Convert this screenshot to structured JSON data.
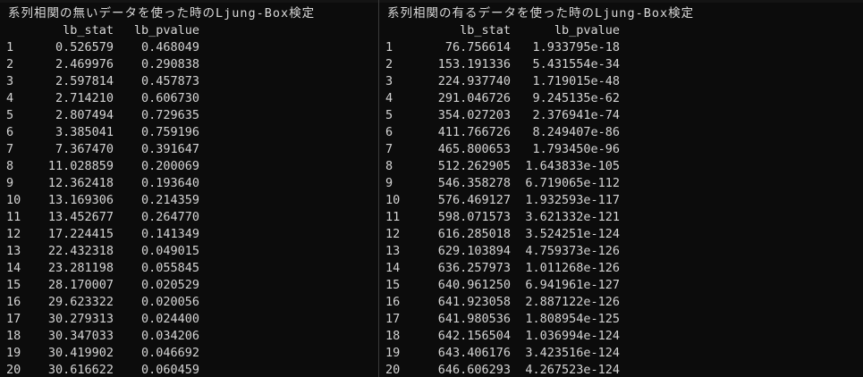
{
  "colors": {
    "background": "#0c0c0c",
    "text": "#d4d4d4",
    "divider": "#3a3a3a"
  },
  "left": {
    "title": "系列相関の無いデータを使った時のLjung-Box検定",
    "columns": {
      "stat": "lb_stat",
      "pval": "lb_pvalue"
    },
    "rows": [
      [
        "1",
        "0.526579",
        "0.468049"
      ],
      [
        "2",
        "2.469976",
        "0.290838"
      ],
      [
        "3",
        "2.597814",
        "0.457873"
      ],
      [
        "4",
        "2.714210",
        "0.606730"
      ],
      [
        "5",
        "2.807494",
        "0.729635"
      ],
      [
        "6",
        "3.385041",
        "0.759196"
      ],
      [
        "7",
        "7.367470",
        "0.391647"
      ],
      [
        "8",
        "11.028859",
        "0.200069"
      ],
      [
        "9",
        "12.362418",
        "0.193640"
      ],
      [
        "10",
        "13.169306",
        "0.214359"
      ],
      [
        "11",
        "13.452677",
        "0.264770"
      ],
      [
        "12",
        "17.224415",
        "0.141349"
      ],
      [
        "13",
        "22.432318",
        "0.049015"
      ],
      [
        "14",
        "23.281198",
        "0.055845"
      ],
      [
        "15",
        "28.170007",
        "0.020529"
      ],
      [
        "16",
        "29.623322",
        "0.020056"
      ],
      [
        "17",
        "30.279313",
        "0.024400"
      ],
      [
        "18",
        "30.347033",
        "0.034206"
      ],
      [
        "19",
        "30.419902",
        "0.046692"
      ],
      [
        "20",
        "30.616622",
        "0.060459"
      ]
    ]
  },
  "right": {
    "title": "系列相関の有るデータを使った時のLjung-Box検定",
    "columns": {
      "stat": "lb_stat",
      "pval": "lb_pvalue"
    },
    "rows": [
      [
        "1",
        "76.756614",
        "1.933795e-18"
      ],
      [
        "2",
        "153.191336",
        "5.431554e-34"
      ],
      [
        "3",
        "224.937740",
        "1.719015e-48"
      ],
      [
        "4",
        "291.046726",
        "9.245135e-62"
      ],
      [
        "5",
        "354.027203",
        "2.376941e-74"
      ],
      [
        "6",
        "411.766726",
        "8.249407e-86"
      ],
      [
        "7",
        "465.800653",
        "1.793450e-96"
      ],
      [
        "8",
        "512.262905",
        "1.643833e-105"
      ],
      [
        "9",
        "546.358278",
        "6.719065e-112"
      ],
      [
        "10",
        "576.469127",
        "1.932593e-117"
      ],
      [
        "11",
        "598.071573",
        "3.621332e-121"
      ],
      [
        "12",
        "616.285018",
        "3.524251e-124"
      ],
      [
        "13",
        "629.103894",
        "4.759373e-126"
      ],
      [
        "14",
        "636.257973",
        "1.011268e-126"
      ],
      [
        "15",
        "640.961250",
        "6.941961e-127"
      ],
      [
        "16",
        "641.923058",
        "2.887122e-126"
      ],
      [
        "17",
        "641.980536",
        "1.808954e-125"
      ],
      [
        "18",
        "642.156504",
        "1.036994e-124"
      ],
      [
        "19",
        "643.406176",
        "3.423516e-124"
      ],
      [
        "20",
        "646.606293",
        "4.267523e-124"
      ]
    ]
  }
}
